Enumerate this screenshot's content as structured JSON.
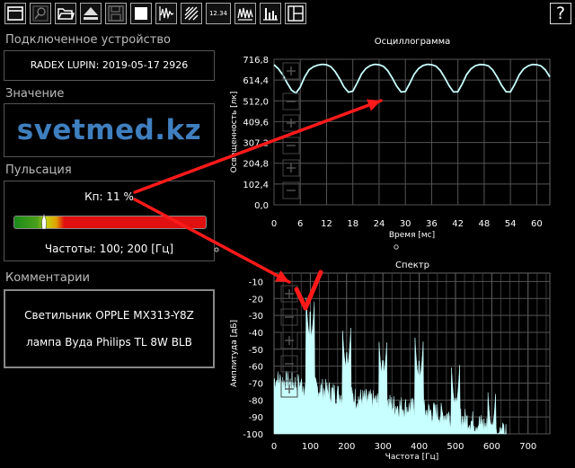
{
  "toolbar": {
    "icons": [
      "window-icon",
      "search-icon",
      "folder-open-icon",
      "eject-icon",
      "save-icon",
      "stop-icon",
      "waveform-icon",
      "pattern-icon",
      "counter-icon",
      "oscillogram-icon",
      "spectrum-icon",
      "layout-icon"
    ],
    "counter_text": "12.34",
    "help_label": "?"
  },
  "device": {
    "section_label": "Подключенное устройство",
    "text": "RADEX LUPIN: 2019-05-17 2926"
  },
  "value": {
    "section_label": "Значение",
    "text": "svetmed.kz"
  },
  "pulsation": {
    "section_label": "Пульсация",
    "kp_text": "Кп: 11 %",
    "kp_fraction": 0.11,
    "freq_text": "Частоты: 100; 200 [Гц]"
  },
  "comments": {
    "section_label": "Комментарии",
    "line1": "Светильник OPPLE MX313-Y8Z",
    "line2": "лампа Вуда Philips TL 8W BLB"
  },
  "colors": {
    "accent_text": "#3f7fbf",
    "trace": "#c8ffff",
    "arrow": "#ff1a1a"
  },
  "chart_data": [
    {
      "type": "line",
      "title": "Осциллограмма",
      "xlabel": "Время [мс]",
      "ylabel": "Освещенность [лк]",
      "xlim": [
        0,
        63
      ],
      "ylim": [
        0,
        716.8
      ],
      "xticks": [
        "0",
        "6",
        "12",
        "18",
        "24",
        "30",
        "36",
        "42",
        "48",
        "54",
        "60"
      ],
      "yticks": [
        "0,0",
        "102,4",
        "204,8",
        "307,2",
        "409,6",
        "512,0",
        "614,4",
        "716,8"
      ],
      "grid": true,
      "x": [
        0,
        1,
        2,
        3,
        4,
        5,
        6,
        7,
        8,
        9,
        10,
        11,
        12,
        13,
        14,
        15,
        16,
        17,
        18,
        19,
        20,
        21,
        22,
        23,
        24,
        25,
        26,
        27,
        28,
        29,
        30,
        31,
        32,
        33,
        34,
        35,
        36,
        37,
        38,
        39,
        40,
        41,
        42,
        43,
        44,
        45,
        46,
        47,
        48,
        49,
        50,
        51,
        52,
        53,
        54,
        55,
        56,
        57,
        58,
        59,
        60,
        61,
        62,
        63
      ],
      "y": [
        690,
        670,
        640,
        600,
        565,
        550,
        580,
        630,
        665,
        680,
        688,
        692,
        690,
        680,
        655,
        620,
        580,
        555,
        560,
        600,
        645,
        672,
        686,
        692,
        690,
        682,
        660,
        625,
        585,
        556,
        558,
        598,
        643,
        671,
        686,
        692,
        690,
        683,
        661,
        626,
        586,
        556,
        557,
        596,
        642,
        670,
        685,
        691,
        690,
        684,
        663,
        628,
        588,
        557,
        556,
        594,
        640,
        669,
        684,
        691,
        690,
        684,
        664,
        630
      ]
    },
    {
      "type": "area",
      "title": "Спектр",
      "xlabel": "Частота [Гц]",
      "ylabel": "Амплитуда [дБ]",
      "xlim": [
        0,
        760
      ],
      "ylim": [
        -100,
        -5
      ],
      "xticks": [
        "0",
        "100",
        "200",
        "300",
        "400",
        "500",
        "600",
        "700"
      ],
      "yticks": [
        "-10",
        "-20",
        "-30",
        "-40",
        "-50",
        "-60",
        "-70",
        "-80",
        "-90",
        "-100"
      ],
      "grid": true,
      "peaks": [
        {
          "x": 100,
          "y": -28
        },
        {
          "x": 200,
          "y": -52
        },
        {
          "x": 300,
          "y": -57
        },
        {
          "x": 400,
          "y": -57
        },
        {
          "x": 500,
          "y": -79
        },
        {
          "x": 600,
          "y": -95
        }
      ],
      "noise_floor": [
        {
          "x": 0,
          "y": -68
        },
        {
          "x": 100,
          "y": -72
        },
        {
          "x": 200,
          "y": -78
        },
        {
          "x": 300,
          "y": -82
        },
        {
          "x": 400,
          "y": -86
        },
        {
          "x": 500,
          "y": -90
        },
        {
          "x": 580,
          "y": -95
        },
        {
          "x": 620,
          "y": -100
        }
      ]
    }
  ]
}
